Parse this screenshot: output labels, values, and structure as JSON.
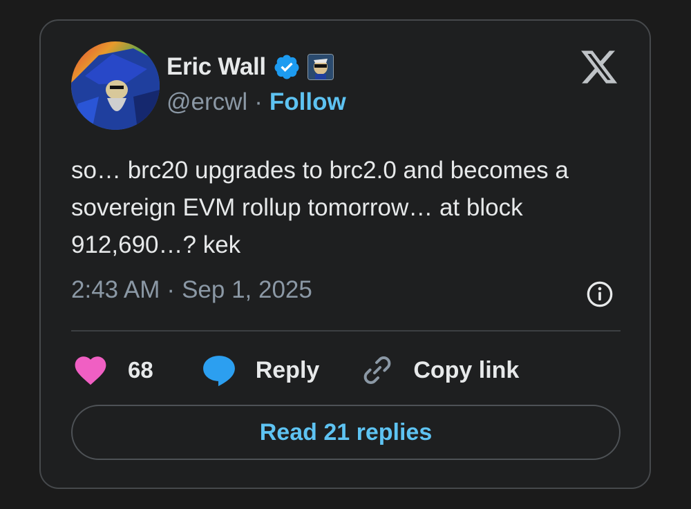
{
  "author": {
    "name": "Eric Wall",
    "handle": "@ercwl",
    "separator": "·",
    "follow_label": "Follow"
  },
  "icons": {
    "verified": "verified-badge-icon",
    "affiliation": "affiliation-badge-icon",
    "platform": "x-logo-icon",
    "info": "info-icon",
    "like": "heart-icon",
    "reply": "speech-bubble-icon",
    "copy": "link-icon"
  },
  "tweet": {
    "text": "so… brc20 upgrades to brc2.0 and becomes a sovereign EVM rollup tomorrow… at block 912,690…? kek",
    "time": "2:43 AM",
    "date": "Sep 1, 2025",
    "separator": "·"
  },
  "actions": {
    "like_count": "68",
    "reply_label": "Reply",
    "copy_label": "Copy link"
  },
  "read_replies_label": "Read 21 replies",
  "colors": {
    "background": "#1b1b1b",
    "card": "#1e1f20",
    "accent": "#5ec3f2",
    "heart": "#f05fc3",
    "verified": "#1d9bf0",
    "secondary_text": "#8b98a5"
  }
}
